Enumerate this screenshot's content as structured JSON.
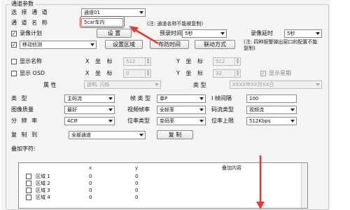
{
  "group_title": "通道参数",
  "channel": {
    "label": "选 择 通 道",
    "value": "通道01"
  },
  "channel_name": {
    "label": "通 道 名 称",
    "value": "5car车内",
    "note": "(注: 通道名称不能被复制)"
  },
  "record_plan": {
    "label": "录像计划",
    "checked": true,
    "settings_button": "设  置",
    "prerecord_label": "预录时间",
    "prerecord_value": "5秒",
    "delay_label": "录像延时",
    "delay_value": "5秒"
  },
  "motion": {
    "checked": true,
    "value": "移动侦测",
    "area_button": "设置区域",
    "arm_button": "布防时间",
    "linkage_button": "联动方式",
    "note": "(注: 四种报警弹出窗口的配置不能复制)"
  },
  "show_name": {
    "label": "显示名称",
    "x_label": "X 坐 标",
    "x_value": "512",
    "y_label": "Y 坐 标",
    "y_value": "512"
  },
  "show_osd": {
    "label": "显示 OSD",
    "x_label": "X 坐 标",
    "x_value": "0",
    "y_label": "Y 坐 标",
    "y_value": "32",
    "show_week_label": "显示星期",
    "attr_label": "属       性",
    "attr_value": "透明, 闪烁",
    "type_label": "类      型",
    "type_value": "XXXX年XX月XX日"
  },
  "stream": {
    "type_label": "类  型",
    "type_value": "主码流",
    "frame_type_label": "帧 类 型",
    "frame_type_value": "单P",
    "iframe_label": "I 帧间隔",
    "iframe_value": "100",
    "quality_label": "图像质量",
    "quality_value": "最好",
    "fps_label": "视频帧率",
    "fps_value": "全帧率",
    "stream_type_label": "码流类型",
    "stream_type_value": "视频流",
    "resolution_label": "分 辨 率",
    "resolution_value": "4CIF",
    "bitrate_type_label": "位率类型",
    "bitrate_type_value": "变码率",
    "bitrate_max_label": "位率上限",
    "bitrate_max_value": "512Kbps"
  },
  "copy": {
    "label": "复 制 到",
    "value": "全部通道",
    "button": "复  制"
  },
  "overlay": {
    "label": "叠加字符:",
    "columns": [
      "x",
      "y",
      "叠加内容"
    ],
    "rows": [
      {
        "name": "区域 1",
        "x": "0",
        "y": "0",
        "content": ""
      },
      {
        "name": "区域 2",
        "x": "0",
        "y": "0",
        "content": ""
      },
      {
        "name": "区域 3",
        "x": "0",
        "y": "0",
        "content": ""
      },
      {
        "name": "区域 4",
        "x": "0",
        "y": "0",
        "content": ""
      }
    ]
  },
  "colors": {
    "highlight": "#e53935",
    "window_bg": "#f4f4f4"
  }
}
